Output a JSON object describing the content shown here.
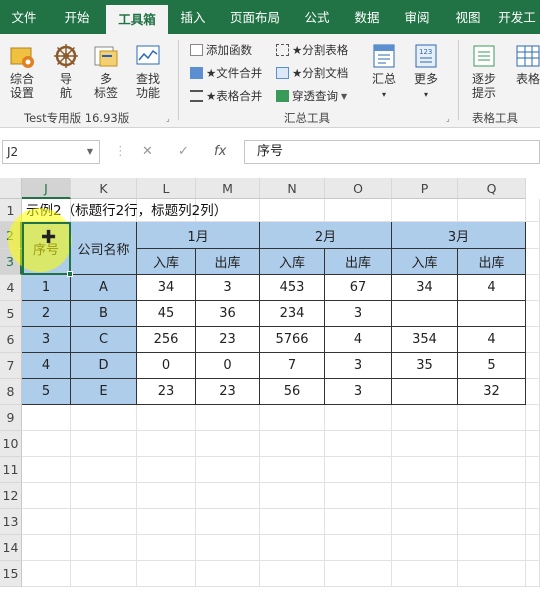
{
  "ribbon_tabs": [
    "文件",
    "开始",
    "工具箱",
    "插入",
    "页面布局",
    "公式",
    "数据",
    "审阅",
    "视图",
    "开发工"
  ],
  "active_tab_index": 2,
  "groups": {
    "g1": {
      "big_buttons": [
        {
          "label1": "综合",
          "label2": "设置"
        },
        {
          "label1": "导",
          "label2": "航"
        },
        {
          "label1": "多",
          "label2": "标签"
        },
        {
          "label1": "查找",
          "label2": "功能"
        }
      ],
      "label": "Test专用版 16.93版"
    },
    "g2": {
      "small_buttons": [
        "添加函数",
        "★文件合并",
        "★表格合并",
        "★分割表格",
        "★分割文档",
        "穿透查询"
      ],
      "big_buttons": [
        {
          "label": "汇总"
        },
        {
          "label": "更多"
        }
      ],
      "label": "汇总工具"
    },
    "g3": {
      "big_buttons": [
        {
          "label1": "逐步",
          "label2": "提示"
        },
        {
          "label1": "表格",
          "label2": ""
        }
      ],
      "label": "表格工具"
    }
  },
  "formula_bar": {
    "name_box": "J2",
    "fx": "fx",
    "value": "序号"
  },
  "columns": [
    "J",
    "K",
    "L",
    "M",
    "N",
    "O",
    "P",
    "Q"
  ],
  "rows": [
    "1",
    "2",
    "3",
    "4",
    "5",
    "6",
    "7",
    "8",
    "9",
    "10",
    "11",
    "12",
    "13",
    "14",
    "15"
  ],
  "sheet": {
    "title": "示例2（标题行2行，标题列2列）",
    "headers": {
      "seq": "序号",
      "company": "公司名称",
      "months": [
        "1月",
        "2月",
        "3月"
      ],
      "sub": [
        "入库",
        "出库",
        "入库",
        "出库",
        "入库",
        "出库"
      ]
    },
    "data_rows": [
      {
        "seq": "1",
        "company": "A",
        "v": [
          "34",
          "3",
          "453",
          "67",
          "34",
          "4"
        ]
      },
      {
        "seq": "2",
        "company": "B",
        "v": [
          "45",
          "36",
          "234",
          "3",
          "",
          ""
        ]
      },
      {
        "seq": "3",
        "company": "C",
        "v": [
          "256",
          "23",
          "5766",
          "4",
          "354",
          "4"
        ]
      },
      {
        "seq": "4",
        "company": "D",
        "v": [
          "0",
          "0",
          "7",
          "3",
          "35",
          "5"
        ]
      },
      {
        "seq": "5",
        "company": "E",
        "v": [
          "23",
          "23",
          "56",
          "3",
          "",
          "32"
        ]
      }
    ]
  },
  "colors": {
    "excel_green": "#217346",
    "header_fill": "#aecdeb",
    "highlight": "#ffff00"
  }
}
